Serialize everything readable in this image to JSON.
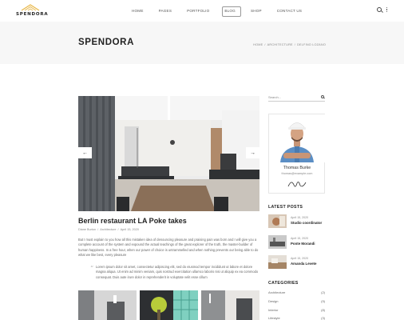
{
  "brand": {
    "name": "SPENDORA"
  },
  "nav": {
    "items": [
      {
        "label": "HOME"
      },
      {
        "label": "PAGES"
      },
      {
        "label": "PORTFOLIO"
      },
      {
        "label": "BLOG"
      },
      {
        "label": "SHOP"
      },
      {
        "label": "CONTACT US"
      }
    ],
    "active_index": 3
  },
  "header_icons": [
    "search-icon",
    "more-vertical-icon"
  ],
  "page": {
    "title": "SPENDORA",
    "breadcrumb": [
      "HOME",
      "/",
      "ARCHITECTURE",
      "/",
      "DELFINO LOZANO"
    ]
  },
  "post": {
    "title": "Berlin restaurant LA Poke takes",
    "meta": [
      "Diane Burton",
      "/",
      "Architecture",
      "/",
      "April 15, 2020"
    ],
    "excerpt": "But I must explain to you how all this mistaken idea of denouncing pleasure and praising pain was born and I will give you a complete account of the system and expound the actual teachings of the great explorer of the truth, the master-builder of human happiness. In a free hour, when our power of choice is untrammelled and when nothing prevents our being able to do what we like best, every pleasure",
    "quote": "Lorem ipsum dolor sit amet, consectetur adipiscing elit, sed do eiusmod tempor incididunt ut labore et dolore magna aliqua. Ut enim ad minim veniam, quis nostrud exercitation ullamco laboris nisi ut aliquip ex ea commodo consequat. Duis aute irure dolor in reprehenderit in voluptate velit esse cillum",
    "slider_prev": "←",
    "slider_next": "→"
  },
  "sidebar": {
    "search_placeholder": "Search...",
    "author": {
      "name": "Thomas Burke",
      "email": "thomas@example.com"
    },
    "latest_posts_title": "LATEST POSTS",
    "latest_posts": [
      {
        "date": "April 15, 2020",
        "title": "Studio coordinator"
      },
      {
        "date": "April 15, 2020",
        "title": "Ponte Morandi"
      },
      {
        "date": "April 15, 2020",
        "title": "Amanda Levete"
      }
    ],
    "categories_title": "CATEGORIES",
    "categories": [
      {
        "name": "Architecture",
        "count": "(2)"
      },
      {
        "name": "Design",
        "count": "(9)"
      },
      {
        "name": "Interior",
        "count": "(8)"
      },
      {
        "name": "Lifestyle",
        "count": "(3)"
      }
    ]
  },
  "colors": {
    "accent": "#e8b84b",
    "title_band": "#f7f7f7",
    "text_dark": "#222222"
  }
}
